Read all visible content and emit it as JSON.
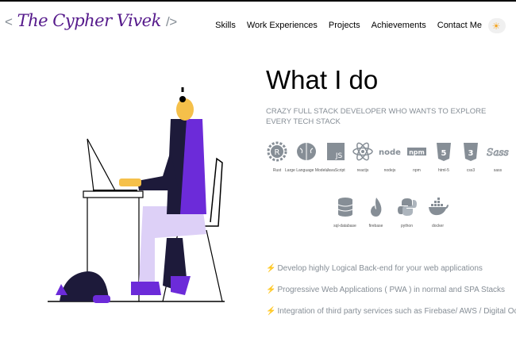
{
  "logo": {
    "open": "<",
    "text": "The Cypher Vivek",
    "close": "/>"
  },
  "nav": [
    "Skills",
    "Work Experiences",
    "Projects",
    "Achievements",
    "Contact Me"
  ],
  "section": {
    "title": "What I do",
    "subtitle": "CRAZY FULL STACK DEVELOPER WHO WANTS TO EXPLORE EVERY TECH STACK"
  },
  "skills_row1": [
    {
      "label": "Rust",
      "icon": "rust-icon"
    },
    {
      "label": "Large Language Models",
      "icon": "brain-icon"
    },
    {
      "label": "JavaScript",
      "icon": "javascript-icon"
    },
    {
      "label": "reactjs",
      "icon": "react-icon"
    },
    {
      "label": "nodejs",
      "icon": "nodejs-icon"
    },
    {
      "label": "npm",
      "icon": "npm-icon"
    },
    {
      "label": "html-5",
      "icon": "html5-icon"
    },
    {
      "label": "css3",
      "icon": "css3-icon"
    },
    {
      "label": "sass",
      "icon": "sass-icon"
    }
  ],
  "skills_row2": [
    {
      "label": "sql-database",
      "icon": "database-icon"
    },
    {
      "label": "firebase",
      "icon": "firebase-icon"
    },
    {
      "label": "python",
      "icon": "python-icon"
    },
    {
      "label": "docker",
      "icon": "docker-icon"
    }
  ],
  "bullets": [
    "Develop highly Logical Back-end for your web applications",
    "Progressive Web Applications ( PWA ) in normal and SPA Stacks",
    "Integration of third party services such as Firebase/ AWS / Digital Ocean"
  ],
  "bolt_glyph": "⚡",
  "toggle_glyph": "☀",
  "colors": {
    "accent": "#55198b",
    "purple": "#6c2bd9",
    "muted": "#868e96",
    "bolt": "#f5a623"
  }
}
